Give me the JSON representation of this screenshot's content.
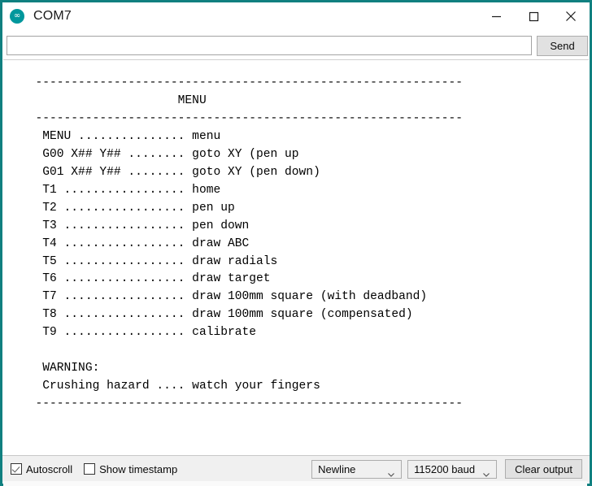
{
  "window": {
    "title": "COM7",
    "icon": "arduino-logo-icon",
    "accent_color": "#108080",
    "controls": {
      "minimize": "minimize-icon",
      "maximize": "maximize-icon",
      "close": "close-icon"
    }
  },
  "send_row": {
    "input_value": "",
    "input_placeholder": "",
    "send_label": "Send"
  },
  "console": {
    "text": "  ------------------------------------------------------------\n                      MENU\n  ------------------------------------------------------------\n   MENU ............... menu\n   G00 X## Y## ........ goto XY (pen up\n   G01 X## Y## ........ goto XY (pen down)\n   T1 ................. home\n   T2 ................. pen up\n   T3 ................. pen down\n   T4 ................. draw ABC\n   T5 ................. draw radials\n   T6 ................. draw target\n   T7 ................. draw 100mm square (with deadband)\n   T8 ................. draw 100mm square (compensated)\n   T9 ................. calibrate\n\n   WARNING:\n   Crushing hazard .... watch your fingers\n  ------------------------------------------------------------",
    "lines": [
      "  ------------------------------------------------------------",
      "                      MENU",
      "  ------------------------------------------------------------",
      "   MENU ............... menu",
      "   G00 X## Y## ........ goto XY (pen up",
      "   G01 X## Y## ........ goto XY (pen down)",
      "   T1 ................. home",
      "   T2 ................. pen up",
      "   T3 ................. pen down",
      "   T4 ................. draw ABC",
      "   T5 ................. draw radials",
      "   T6 ................. draw target",
      "   T7 ................. draw 100mm square (with deadband)",
      "   T8 ................. draw 100mm square (compensated)",
      "   T9 ................. calibrate",
      "",
      "   WARNING:",
      "   Crushing hazard .... watch your fingers",
      "  ------------------------------------------------------------"
    ],
    "menu_title": "MENU",
    "commands": [
      {
        "cmd": "MENU",
        "desc": "menu"
      },
      {
        "cmd": "G00 X## Y##",
        "desc": "goto XY (pen up"
      },
      {
        "cmd": "G01 X## Y##",
        "desc": "goto XY (pen down)"
      },
      {
        "cmd": "T1",
        "desc": "home"
      },
      {
        "cmd": "T2",
        "desc": "pen up"
      },
      {
        "cmd": "T3",
        "desc": "pen down"
      },
      {
        "cmd": "T4",
        "desc": "draw ABC"
      },
      {
        "cmd": "T5",
        "desc": "draw radials"
      },
      {
        "cmd": "T6",
        "desc": "draw target"
      },
      {
        "cmd": "T7",
        "desc": "draw 100mm square (with deadband)"
      },
      {
        "cmd": "T8",
        "desc": "draw 100mm square (compensated)"
      },
      {
        "cmd": "T9",
        "desc": "calibrate"
      }
    ],
    "warning_label": "WARNING:",
    "warning_text": "Crushing hazard .... watch your fingers"
  },
  "toolbar": {
    "autoscroll_label": "Autoscroll",
    "autoscroll_checked": true,
    "show_timestamp_label": "Show timestamp",
    "show_timestamp_checked": false,
    "line_ending_value": "Newline",
    "baud_value": "115200 baud",
    "clear_output_label": "Clear output"
  }
}
